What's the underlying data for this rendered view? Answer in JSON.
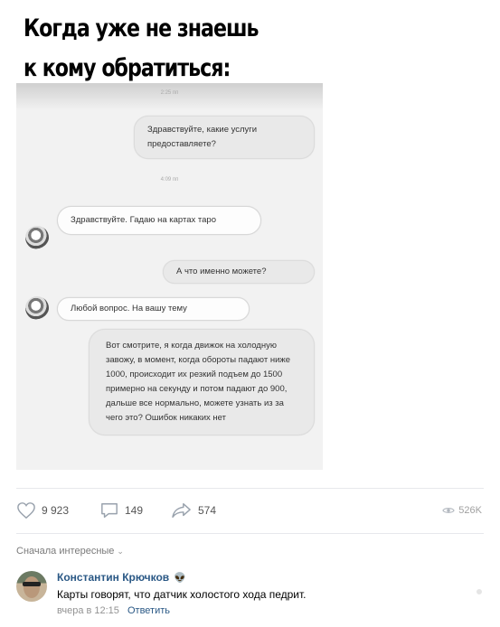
{
  "post": {
    "title": "Когда уже не знаешь к кому обратиться:",
    "chat": {
      "time1": "2:25 пп",
      "time2": "4:09 пп",
      "messages": [
        {
          "side": "out",
          "text": "Здравствуйте, какие услуги предоставляете?"
        },
        {
          "side": "in",
          "text": "Здравствуйте. Гадаю на картах таро"
        },
        {
          "side": "out",
          "text": "А что именно можете?"
        },
        {
          "side": "in",
          "text": "Любой вопрос. На вашу тему"
        },
        {
          "side": "out",
          "text": "Вот смотрите, я когда движок на холодную завожу, в момент, когда обороты падают ниже 1000, происходит их резкий подъем до 1500 примерно на секунду и потом падают до 900, дальше все нормально, можете узнать из за чего это? Ошибок никаких нет"
        }
      ]
    }
  },
  "actions": {
    "likes": "9 923",
    "comments": "149",
    "shares": "574",
    "views": "526K"
  },
  "comments_section": {
    "sort_label": "Сначала интересные",
    "comment": {
      "author": "Константин Крючков",
      "author_badge": "👽",
      "text": "Карты говорят, что датчик холостого хода педрит.",
      "time": "вчера в 12:15",
      "reply_label": "Ответить"
    }
  },
  "colors": {
    "link": "#2a5885",
    "muted": "#939393",
    "divider": "#e7e8ec"
  }
}
